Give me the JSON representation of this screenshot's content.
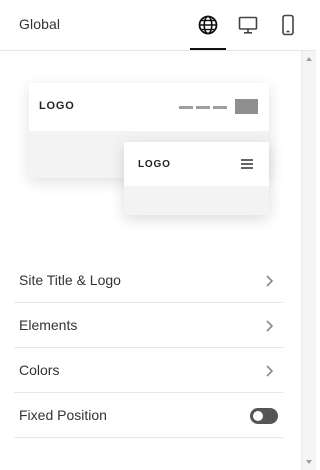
{
  "header": {
    "title": "Global",
    "tabs": [
      {
        "icon": "globe-icon",
        "active": true
      },
      {
        "icon": "desktop-icon",
        "active": false
      },
      {
        "icon": "mobile-icon",
        "active": false
      }
    ]
  },
  "preview": {
    "desktop_logo": "LOGO",
    "mobile_logo": "LOGO"
  },
  "settings": {
    "items": [
      {
        "label": "Site Title & Logo",
        "control": "chevron"
      },
      {
        "label": "Elements",
        "control": "chevron"
      },
      {
        "label": "Colors",
        "control": "chevron"
      },
      {
        "label": "Fixed Position",
        "control": "toggle",
        "value": false
      }
    ]
  },
  "colors": {
    "accent": "#111111",
    "toggle_off": "#555555",
    "divider": "#e8e8e8"
  }
}
